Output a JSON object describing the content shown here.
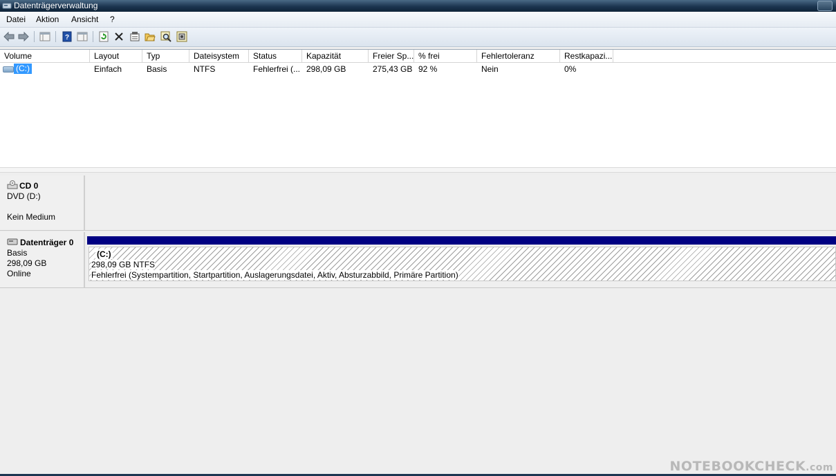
{
  "window": {
    "title": "Datenträgerverwaltung"
  },
  "menu": {
    "items": [
      "Datei",
      "Aktion",
      "Ansicht",
      "?"
    ]
  },
  "toolbar": {
    "icons": [
      "back-icon",
      "forward-icon",
      "panel-icon",
      "help-icon",
      "panel-view-icon",
      "refresh-icon",
      "delete-icon",
      "properties-icon",
      "open-icon",
      "search-icon",
      "disk-settings-icon"
    ]
  },
  "volume_list": {
    "columns": [
      "Volume",
      "Layout",
      "Typ",
      "Dateisystem",
      "Status",
      "Kapazität",
      "Freier Sp...",
      "% frei",
      "Fehlertoleranz",
      "Restkapazi..."
    ],
    "rows": [
      {
        "volume": "(C:)",
        "layout": "Einfach",
        "typ": "Basis",
        "dateisystem": "NTFS",
        "status": "Fehlerfrei (...",
        "kapazitaet": "298,09 GB",
        "freier": "275,43 GB",
        "frei_prozent": "92 %",
        "fehlertoleranz": "Nein",
        "restkapazitaet": "0%"
      }
    ]
  },
  "disks": [
    {
      "name": "CD 0",
      "line1": "DVD (D:)",
      "line2": "",
      "line3": "Kein Medium"
    },
    {
      "name": "Datenträger 0",
      "line1": "Basis",
      "line2": "298,09 GB",
      "line3": "Online",
      "partition": {
        "label": "(C:)",
        "size": "298,09 GB NTFS",
        "status": "Fehlerfrei (Systempartition, Startpartition, Auslagerungsdatei, Aktiv, Absturzabbild, Primäre Partition)"
      }
    }
  ],
  "watermark": {
    "main": "NOTEBOOKCHECK",
    "suffix": ".com"
  },
  "colors": {
    "selection": "#3399ff",
    "partition_bar": "#000082",
    "titlebar": "#1c3550"
  }
}
